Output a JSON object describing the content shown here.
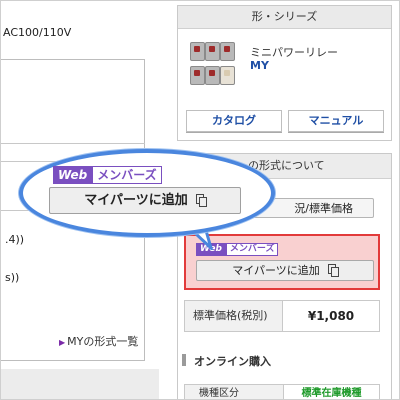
{
  "left": {
    "spec_text": "AC100/110V",
    "frag_1": ".4))",
    "frag_2": "s))",
    "series_link": "MYの形式一覧"
  },
  "panel": {
    "title": "形・シリーズ",
    "product_name": "ミニパワーリレー",
    "product_model": "MY",
    "catalog_label": "カタログ",
    "manual_label": "マニュアル"
  },
  "section2": {
    "title": "の形式について",
    "status_button": "況/標準価格"
  },
  "members_badge": {
    "web": "Web",
    "members": "メンバーズ"
  },
  "add_button_label": "マイパーツに追加",
  "price": {
    "label": "標準価格(税別)",
    "value": "¥1,080"
  },
  "online": {
    "title": "オンライン購入",
    "type_label": "機種区分",
    "type_value": "標準在庫機種"
  },
  "colors": {
    "highlight": "#e23a3a",
    "bubble": "#4a86de",
    "members": "#7a4fc0"
  }
}
